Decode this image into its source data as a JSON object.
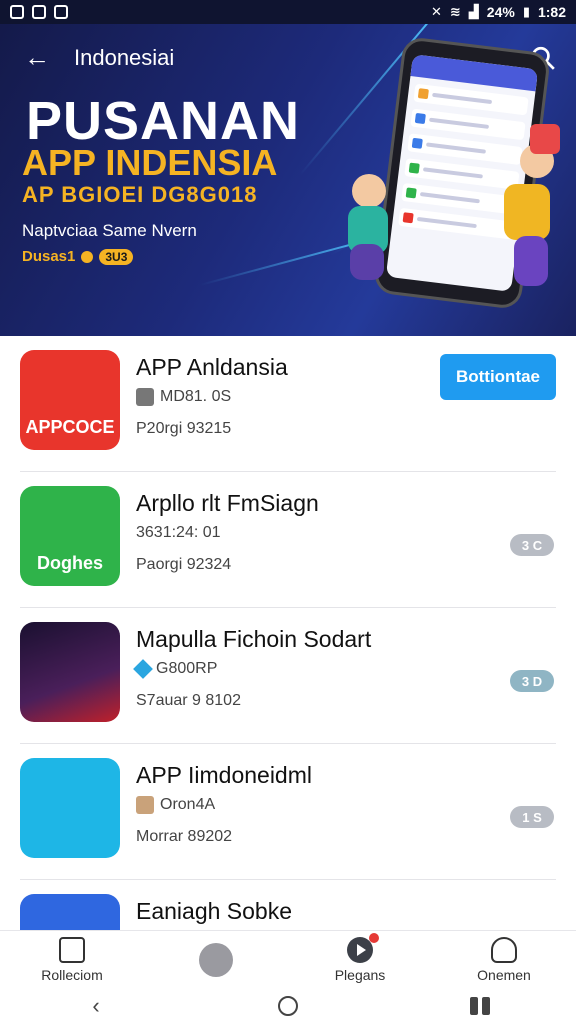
{
  "status_bar": {
    "battery": "24%",
    "time": "1:82"
  },
  "header": {
    "title": "Indonesiai",
    "headline": "PUSANAN",
    "subheadline": "APP INDENSIA",
    "tagline": "AP BGIOEI DG8G018",
    "description": "Naptvciaa Same Nvern",
    "badge_label": "Dusas1",
    "badge_pill": "3U3"
  },
  "apps": [
    {
      "name": "APP Anldansia",
      "meta1": "MD81. 0S",
      "meta2": "P20rgi 93215",
      "icon_text": "APPCOCE",
      "icon_color": "#e8352c",
      "action": "Bottiontae"
    },
    {
      "name": "Arpllo rlt FmSiagn",
      "meta1": "3631:24: 01",
      "meta2": "Paorgi 92324",
      "icon_text": "Doghes",
      "icon_color": "#2fb34a",
      "rank": "3 C"
    },
    {
      "name": "Mapulla Fichoin Sodart",
      "meta1": "G800RP",
      "meta2": "S7auar 9 8102",
      "icon_text": "",
      "icon_color": "#2a1a3e",
      "rank": "3 D"
    },
    {
      "name": "APP Iimdoneidml",
      "meta1": "Oron4A",
      "meta2": "Morrar 89202",
      "icon_text": "",
      "icon_color": "#1eb6e6",
      "rank": "1 S"
    },
    {
      "name": "Eaniagh Sobke",
      "meta1": "",
      "meta2": "",
      "icon_text": "",
      "icon_color": "#2f67e0"
    }
  ],
  "bottom_nav": {
    "items": [
      {
        "label": "Rolleciom",
        "icon": "collection-icon"
      },
      {
        "label": "",
        "icon": "home-icon"
      },
      {
        "label": "Plegans",
        "icon": "play-icon"
      },
      {
        "label": "Onemen",
        "icon": "profile-icon"
      }
    ]
  },
  "colors": {
    "accent": "#1f9bf0",
    "banner_gold": "#f5b323",
    "banner_bg": "#1d2a7a"
  }
}
